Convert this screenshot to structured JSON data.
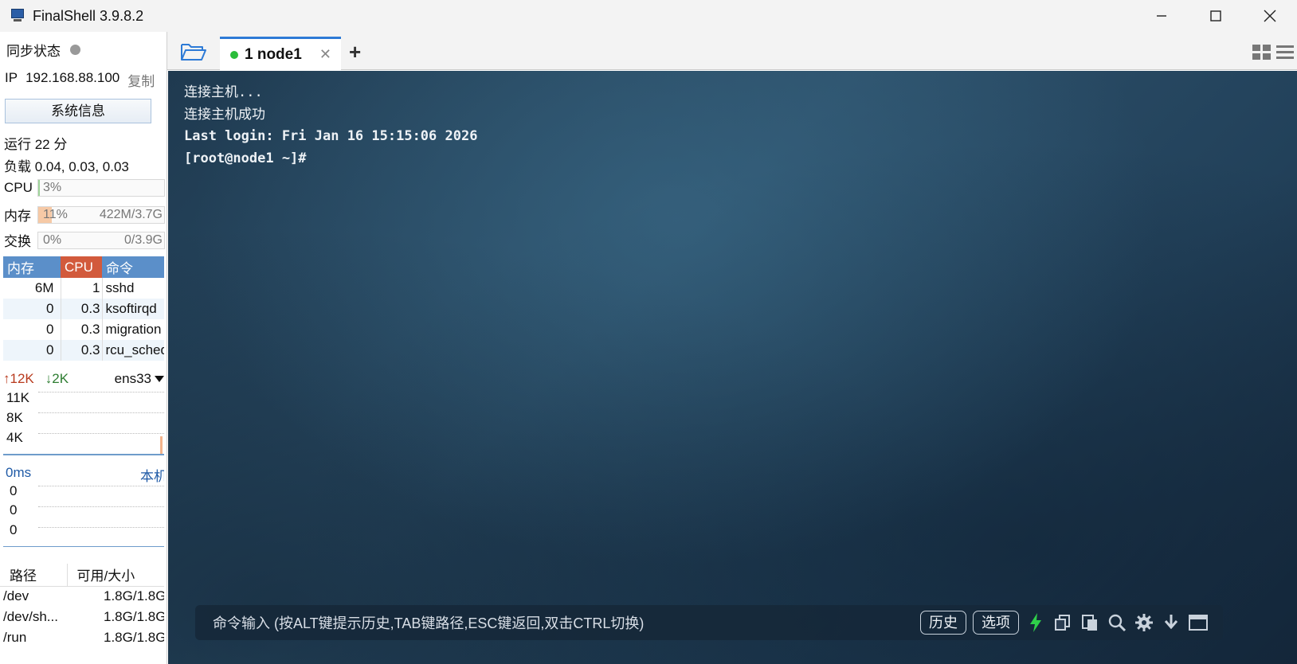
{
  "window": {
    "title": "FinalShell 3.9.8.2",
    "controls": {
      "minimize": "—",
      "maximize": "☐",
      "close": "✕"
    }
  },
  "sidebar": {
    "sync_label": "同步状态",
    "ip_label": "IP",
    "ip_value": "192.168.88.100",
    "copy_label": "复制",
    "sysinfo_button": "系统信息",
    "uptime": "运行 22 分",
    "load": "负载 0.04, 0.03, 0.03",
    "cpu": {
      "label": "CPU",
      "percent_text": "3%",
      "percent": 3
    },
    "memory": {
      "label": "内存",
      "percent_text": "11%",
      "amount": "422M/3.7G",
      "percent": 11
    },
    "swap": {
      "label": "交换",
      "percent_text": "0%",
      "amount": "0/3.9G",
      "percent": 0
    },
    "process_table": {
      "headers": {
        "mem": "内存",
        "cpu": "CPU",
        "cmd": "命令"
      },
      "rows": [
        {
          "mem": "6M",
          "cpu": "1",
          "cmd": "sshd"
        },
        {
          "mem": "0",
          "cpu": "0.3",
          "cmd": "ksoftirqd"
        },
        {
          "mem": "0",
          "cpu": "0.3",
          "cmd": "migration"
        },
        {
          "mem": "0",
          "cpu": "0.3",
          "cmd": "rcu_sched"
        }
      ]
    },
    "network": {
      "up": "12K",
      "down": "2K",
      "interface": "ens33",
      "y_labels": [
        "11K",
        "8K",
        "4K"
      ]
    },
    "ping": {
      "latency": "0ms",
      "host": "本机",
      "y_labels": [
        "0",
        "0",
        "0"
      ]
    },
    "disk_table": {
      "headers": {
        "path": "路径",
        "size": "可用/大小"
      },
      "rows": [
        {
          "path": "/dev",
          "size": "1.8G/1.8G"
        },
        {
          "path": "/dev/sh...",
          "size": "1.8G/1.8G"
        },
        {
          "path": "/run",
          "size": "1.8G/1.8G"
        }
      ]
    }
  },
  "tabs": {
    "items": [
      {
        "label": "1 node1",
        "status_color": "#2bbd3a",
        "active": true
      }
    ],
    "close": "✕",
    "add": "+"
  },
  "terminal": {
    "lines": [
      "连接主机...",
      "连接主机成功",
      "Last login: Fri Jan 16 15:15:06 2026",
      "[root@node1 ~]#"
    ]
  },
  "command_bar": {
    "hint": "命令输入 (按ALT键提示历史,TAB键路径,ESC键返回,双击CTRL切换)",
    "history_button": "历史",
    "options_button": "选项"
  },
  "colors": {
    "accent": "#2d7ad6",
    "cpu_header": "#d25a3c",
    "table_header": "#5b8fc9",
    "upload": "#b83a1d",
    "download": "#2e7d32"
  }
}
